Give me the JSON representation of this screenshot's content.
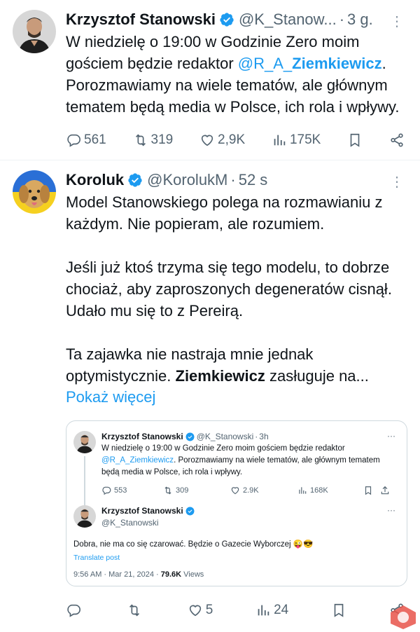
{
  "tweet1": {
    "name": "Krzysztof Stanowski",
    "handle": "@K_Stanow...",
    "dot": "·",
    "time": "3 g.",
    "more": "⋮",
    "text_pre": "W niedzielę o 19:00 w Godzinie Zero moim gościem będzie redaktor ",
    "mention": "@R_A_",
    "mention_bold": "Ziemkiewicz",
    "text_post": ". Porozmawiamy na wiele tematów, ale głównym tematem będą media w Polsce, ich rola i wpływy.",
    "replies": "561",
    "retweets": "319",
    "likes": "2,9K",
    "views": "175K"
  },
  "tweet2": {
    "name": "Koroluk",
    "handle": "@KorolukM",
    "dot": "·",
    "time": "52 s",
    "more": "⋮",
    "p1": "Model Stanowskiego polega na rozmawianiu z każdym. Nie popieram, ale rozumiem.",
    "p2": "Jeśli już ktoś trzyma się tego modelu, to dobrze chociaż, aby zaproszonych degeneratów cisnął. Udało mu się to z Pereirą.",
    "p3_pre": "Ta zajawka nie nastraja mnie jednak optymistycznie. ",
    "p3_bold": "Ziemkiewicz",
    "p3_post": " zasługuje na...",
    "show_more": "Pokaż więcej",
    "replies": "",
    "retweets": "",
    "likes": "5",
    "views": "24"
  },
  "quote": {
    "q1": {
      "name": "Krzysztof Stanowski",
      "handle": "@K_Stanowski",
      "dot": "·",
      "time": "3h",
      "more": "···",
      "text_pre": "W niedzielę o 19:00 w Godzinie Zero moim gościem będzie redaktor ",
      "mention": "@R_A_Ziemkiewicz",
      "text_post": ". Porozmawiamy na wiele tematów, ale głównym tematem będą media w Polsce, ich rola i wpływy.",
      "replies": "553",
      "retweets": "309",
      "likes": "2.9K",
      "views": "168K"
    },
    "q2": {
      "name": "Krzysztof Stanowski",
      "handle": "@K_Stanowski",
      "more": "···",
      "text": "Dobra, nie ma co się czarować. Będzie o Gazecie Wyborczej 😜😎",
      "translate": "Translate post",
      "time": "9:56 AM · Mar 21, 2024 · ",
      "views_count": "79.6K",
      "views_label": " Views"
    }
  },
  "colors": {
    "accent": "#1d9bf0",
    "muted": "#536471",
    "border": "#cfd9de"
  }
}
